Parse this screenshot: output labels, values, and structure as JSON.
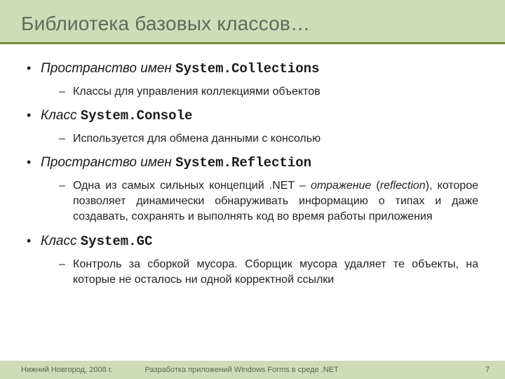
{
  "header": {
    "title": "Библиотека базовых классов…"
  },
  "bullets": [
    {
      "prefix": "Пространство имен ",
      "mono": "System.Collections",
      "sub": [
        {
          "text": "Классы для управления коллекциями объектов"
        }
      ]
    },
    {
      "prefix": "Класс ",
      "mono": "System.Console",
      "sub": [
        {
          "text": "Используется для обмена данными с консолью"
        }
      ]
    },
    {
      "prefix": "Пространство имен ",
      "mono": "System.Reflection",
      "sub": [
        {
          "text_a": "Одна из самых сильных концепций .NET – ",
          "text_em": "отражение",
          "text_b": " (",
          "text_em2": "reflection",
          "text_c": "), которое позволяет динамически обнаруживать информацию о типах и даже создавать, сохранять и выполнять код во время работы приложения"
        }
      ]
    },
    {
      "prefix": "Класс ",
      "mono": "System.GC",
      "sub": [
        {
          "text": "Контроль за сборкой мусора. Сборщик мусора удаляет те объекты, на которые не осталось ни одной корректной ссылки"
        }
      ]
    }
  ],
  "footer": {
    "left": "Нижний Новгород, 2008 г.",
    "center": "Разработка приложений Windows Forms в среде .NET",
    "page": "7"
  }
}
